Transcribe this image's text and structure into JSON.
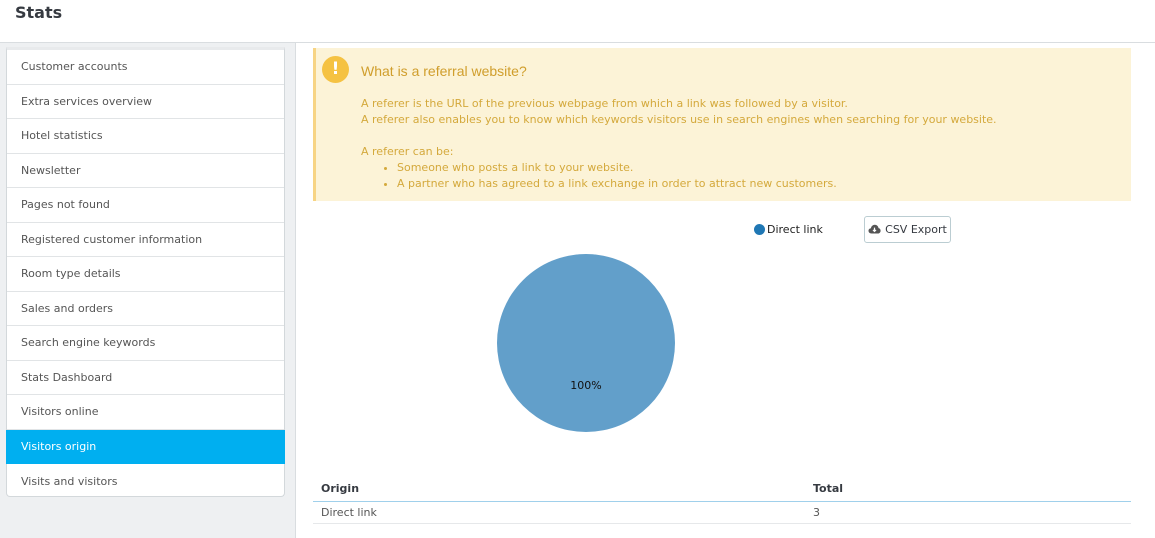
{
  "header": {
    "title": "Stats"
  },
  "sidebar": {
    "items": [
      {
        "label": "Customer accounts"
      },
      {
        "label": "Extra services overview"
      },
      {
        "label": "Hotel statistics"
      },
      {
        "label": "Newsletter"
      },
      {
        "label": "Pages not found"
      },
      {
        "label": "Registered customer information"
      },
      {
        "label": "Room type details"
      },
      {
        "label": "Sales and orders"
      },
      {
        "label": "Search engine keywords"
      },
      {
        "label": "Stats Dashboard"
      },
      {
        "label": "Visitors online"
      },
      {
        "label": "Visitors origin",
        "active": true
      },
      {
        "label": "Visits and visitors"
      }
    ]
  },
  "alert": {
    "icon": "exclamation-icon",
    "title": "What is a referral website?",
    "line1": "A referer is the URL of the previous webpage from which a link was followed by a visitor.",
    "line2": "A referer also enables you to know which keywords visitors use in search engines when searching for your website.",
    "line3": "A referer can be:",
    "bullets": [
      "Someone who posts a link to your website.",
      "A partner who has agreed to a link exchange in order to attract new customers."
    ]
  },
  "toolbar": {
    "csv_label": "CSV Export",
    "csv_icon": "cloud-download-icon"
  },
  "chart_data": {
    "type": "pie",
    "slices": [
      {
        "label": "Direct link",
        "value": 3,
        "percent_label": "100%"
      }
    ],
    "legend": [
      "Direct link"
    ],
    "legend_position": "top-right",
    "colors": {
      "legend": "#1f77b4",
      "slice": "#629fca"
    }
  },
  "table": {
    "headers": [
      "Origin",
      "Total"
    ],
    "rows": [
      [
        "Direct link",
        "3"
      ]
    ]
  }
}
